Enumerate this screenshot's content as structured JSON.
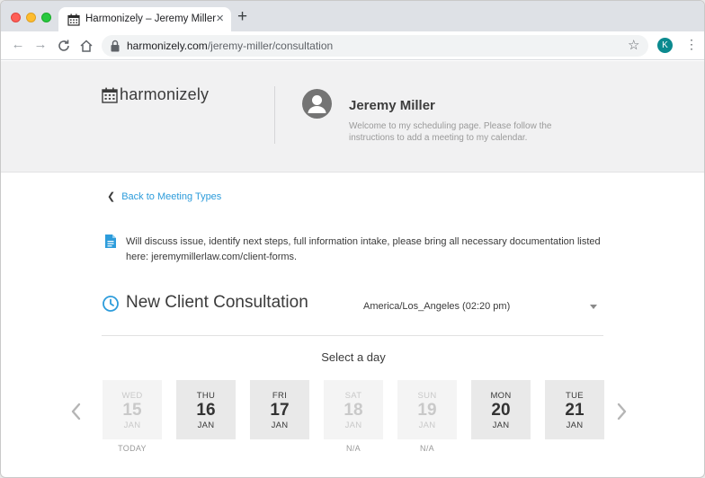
{
  "browser": {
    "tab_title": "Harmonizely – Jeremy Miller",
    "tab_close": "×",
    "new_tab": "+",
    "url_domain": "harmonizely.com",
    "url_path": "/jeremy-miller/consultation",
    "profile_initial": "K"
  },
  "header": {
    "logo_text": "harmonizely",
    "host_name": "Jeremy Miller",
    "host_description": "Welcome to my scheduling page. Please follow the instructions to add a meeting to my calendar."
  },
  "main": {
    "back_link": "Back to Meeting Types",
    "event_description": "Will discuss issue, identify next steps, full information intake, please bring all necessary documentation listed here: jeremymillerlaw.com/client-forms.",
    "event_title": "New Client Consultation",
    "timezone": "America/Los_Angeles (02:20 pm)",
    "select_day_label": "Select a day"
  },
  "days": [
    {
      "dow": "WED",
      "num": "15",
      "mon": "JAN",
      "note": "TODAY",
      "disabled": true
    },
    {
      "dow": "THU",
      "num": "16",
      "mon": "JAN",
      "note": "",
      "disabled": false
    },
    {
      "dow": "FRI",
      "num": "17",
      "mon": "JAN",
      "note": "",
      "disabled": false
    },
    {
      "dow": "SAT",
      "num": "18",
      "mon": "JAN",
      "note": "N/A",
      "disabled": true
    },
    {
      "dow": "SUN",
      "num": "19",
      "mon": "JAN",
      "note": "N/A",
      "disabled": true
    },
    {
      "dow": "MON",
      "num": "20",
      "mon": "JAN",
      "note": "",
      "disabled": false
    },
    {
      "dow": "TUE",
      "num": "21",
      "mon": "JAN",
      "note": "",
      "disabled": false
    }
  ],
  "colors": {
    "link": "#2d9cdb",
    "header_bg": "#f1f1f2",
    "day_enabled_bg": "#e9e9e9",
    "day_disabled_bg": "#f4f4f4",
    "profile_bg": "#0b8a8f"
  }
}
